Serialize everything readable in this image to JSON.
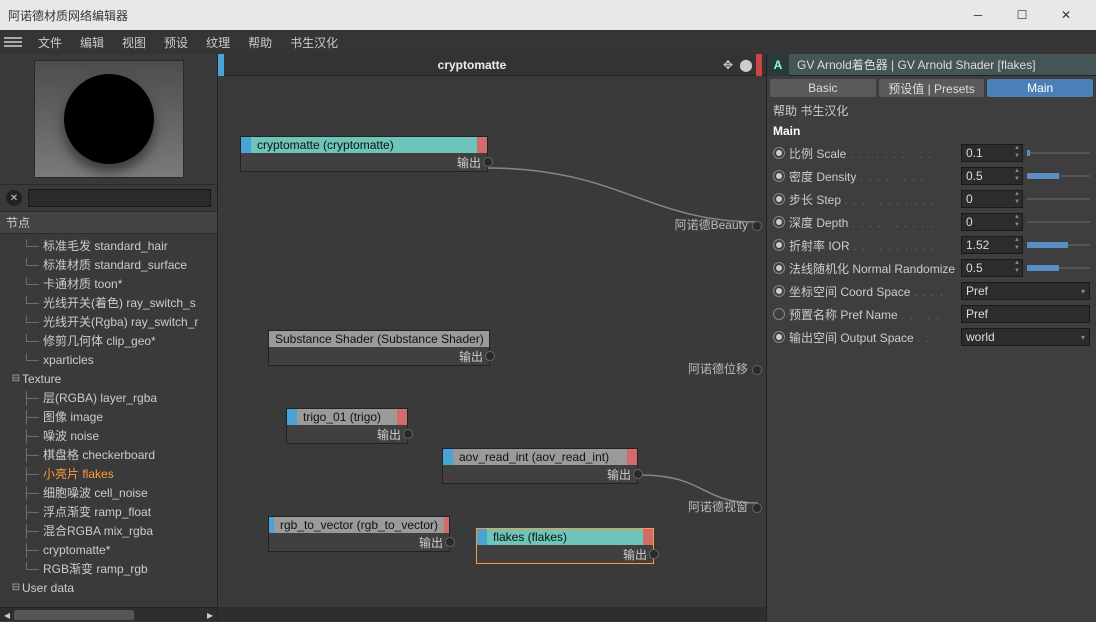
{
  "window": {
    "title": "阿诺德材质网络编辑器"
  },
  "menu": {
    "file": "文件",
    "edit": "编辑",
    "view": "视图",
    "presets": "预设",
    "texture": "纹理",
    "help": "帮助",
    "author": "书生汉化"
  },
  "left": {
    "nodes_header": "节点",
    "tree": {
      "standard_hair": "标准毛发 standard_hair",
      "standard_surface": "标准材质 standard_surface",
      "toon": "卡通材质 toon*",
      "ray_switch_s": "光线开关(着色) ray_switch_s",
      "ray_switch_r": "光线开关(Rgba) ray_switch_r",
      "clip_geo": "修剪几何体 clip_geo*",
      "xparticles": "xparticles",
      "texture_group": "Texture",
      "layer_rgba": "层(RGBA) layer_rgba",
      "image": "图像 image",
      "noise": "噪波 noise",
      "checkerboard": "棋盘格 checkerboard",
      "flakes": "小亮片 flakes",
      "cell_noise": "细胞噪波 cell_noise",
      "ramp_float": "浮点渐变 ramp_float",
      "mix_rgba": "混合RGBA mix_rgba",
      "cryptomatte": "cryptomatte*",
      "ramp_rgb": "RGB渐变 ramp_rgb",
      "user_data": "User data"
    }
  },
  "canvas": {
    "title": "cryptomatte",
    "output_label": "输出",
    "beauty": "阿诺德Beauty",
    "displace": "阿诺德位移",
    "viewport": "阿诺德视窗",
    "nodes": {
      "cryptomatte": "cryptomatte (cryptomatte)",
      "substance": "Substance Shader (Substance Shader)",
      "trigo": "trigo_01 (trigo)",
      "aov": "aov_read_int (aov_read_int)",
      "rgb2vec": "rgb_to_vector (rgb_to_vector)",
      "flakes": "flakes (flakes)"
    }
  },
  "right": {
    "header": "GV Arnold着色器 | GV Arnold Shader [flakes]",
    "tabs": {
      "basic": "Basic",
      "presets": "预设值 | Presets",
      "main": "Main"
    },
    "subbar": "帮助 书生汉化",
    "section": "Main",
    "props": {
      "scale": {
        "label": "比例 Scale",
        "val": "0.1",
        "pct": 4
      },
      "density": {
        "label": "密度 Density",
        "val": "0.5",
        "pct": 50
      },
      "step": {
        "label": "步长 Step",
        "val": "0",
        "pct": 0
      },
      "depth": {
        "label": "深度 Depth",
        "val": "0",
        "pct": 0
      },
      "ior": {
        "label": "折射率 IOR",
        "val": "1.52",
        "pct": 65
      },
      "normal_rand": {
        "label": "法线随机化 Normal Randomize",
        "val": "0.5",
        "pct": 50
      },
      "coord_space": {
        "label": "坐标空间 Coord Space",
        "val": "Pref"
      },
      "pref_name": {
        "label": "预置名称 Pref Name",
        "val": "Pref"
      },
      "output_space": {
        "label": "输出空间 Output Space",
        "val": "world"
      }
    }
  }
}
